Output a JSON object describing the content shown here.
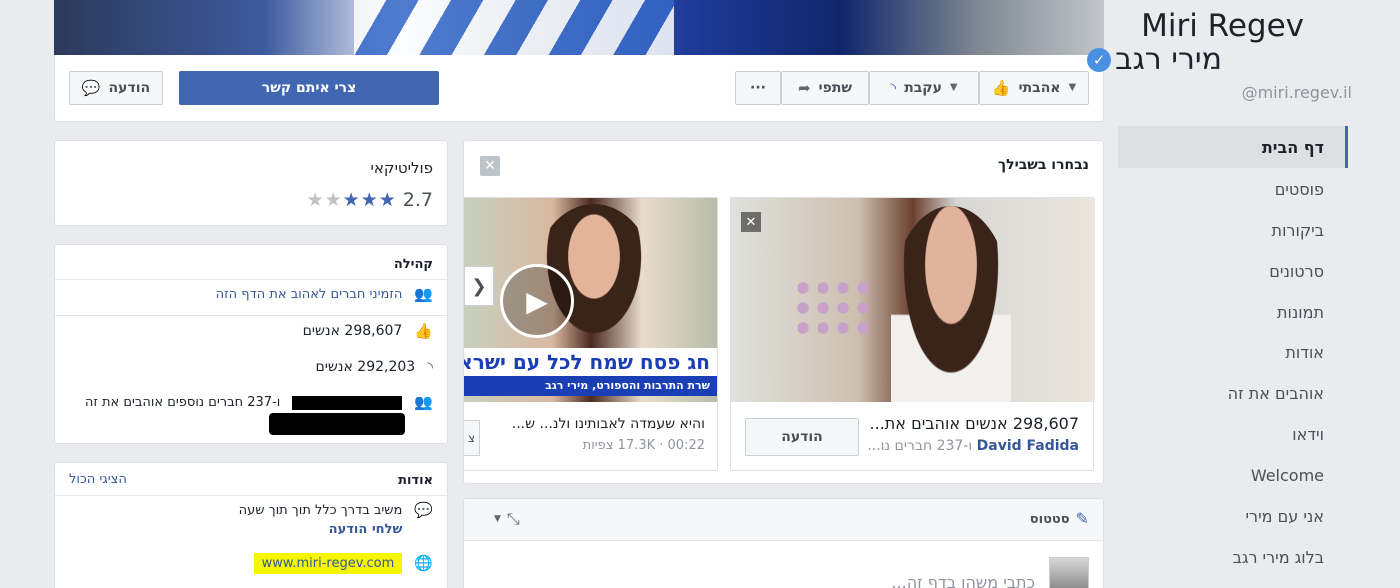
{
  "colors": {
    "fb_blue": "#4267b2",
    "link": "#365899",
    "verified": "#4a90e2",
    "highlight": "#f5f500"
  },
  "sidebar": {
    "name_en": "Miri Regev",
    "name_he": "מירי רגב",
    "handle": "@miri.regev.il",
    "items": [
      {
        "label": "דף הבית",
        "active": true
      },
      {
        "label": "פוסטים"
      },
      {
        "label": "ביקורות"
      },
      {
        "label": "סרטונים"
      },
      {
        "label": "תמונות"
      },
      {
        "label": "אודות"
      },
      {
        "label": "אוהבים את זה"
      },
      {
        "label": "וידאו"
      },
      {
        "label": "Welcome"
      },
      {
        "label": "אני עם מירי"
      },
      {
        "label": "בלוג מירי רגב"
      }
    ]
  },
  "actions": {
    "like": "אהבתי",
    "follow": "עקבת",
    "share": "שתפי",
    "more": "···",
    "contact": "צרי איתם קשר",
    "message": "הודעה"
  },
  "featured": {
    "title": "נבחרו בשבילך",
    "card1": {
      "likes_text": "298,607 אנשים אוהבים את...",
      "friend": "David Fadida",
      "friend_rest": " ו-237 חברים נו...",
      "button": "הודעה"
    },
    "card2": {
      "title": "והיא שעמדה לאבותינו ולנ... ש...",
      "meta": "00:22 · 17.3K צפיות",
      "banner_line1": "חג פסח שמח לכל עם ישראל",
      "banner_line2": "שרת התרבות והספורט, מירי רגב"
    }
  },
  "status": {
    "label": "סטטוס",
    "placeholder": "כתבי משהו בדף זה..."
  },
  "category": {
    "label": "פוליטיקאי",
    "rating": "2.7"
  },
  "community": {
    "title": "קהילה",
    "invite": "הזמיני חברים לאהוב את הדף הזה",
    "likes": "298,607 אנשים",
    "follows": "292,203 אנשים",
    "friends": "ו-237 חברים נוספים אוהבים את זה"
  },
  "about": {
    "title": "אודות",
    "see_all": "הציגי הכול",
    "response": "משיב בדרך כלל תוך תוך שעה",
    "send_message": "שלחי הודעה",
    "website": "www.miri-regev.com"
  }
}
